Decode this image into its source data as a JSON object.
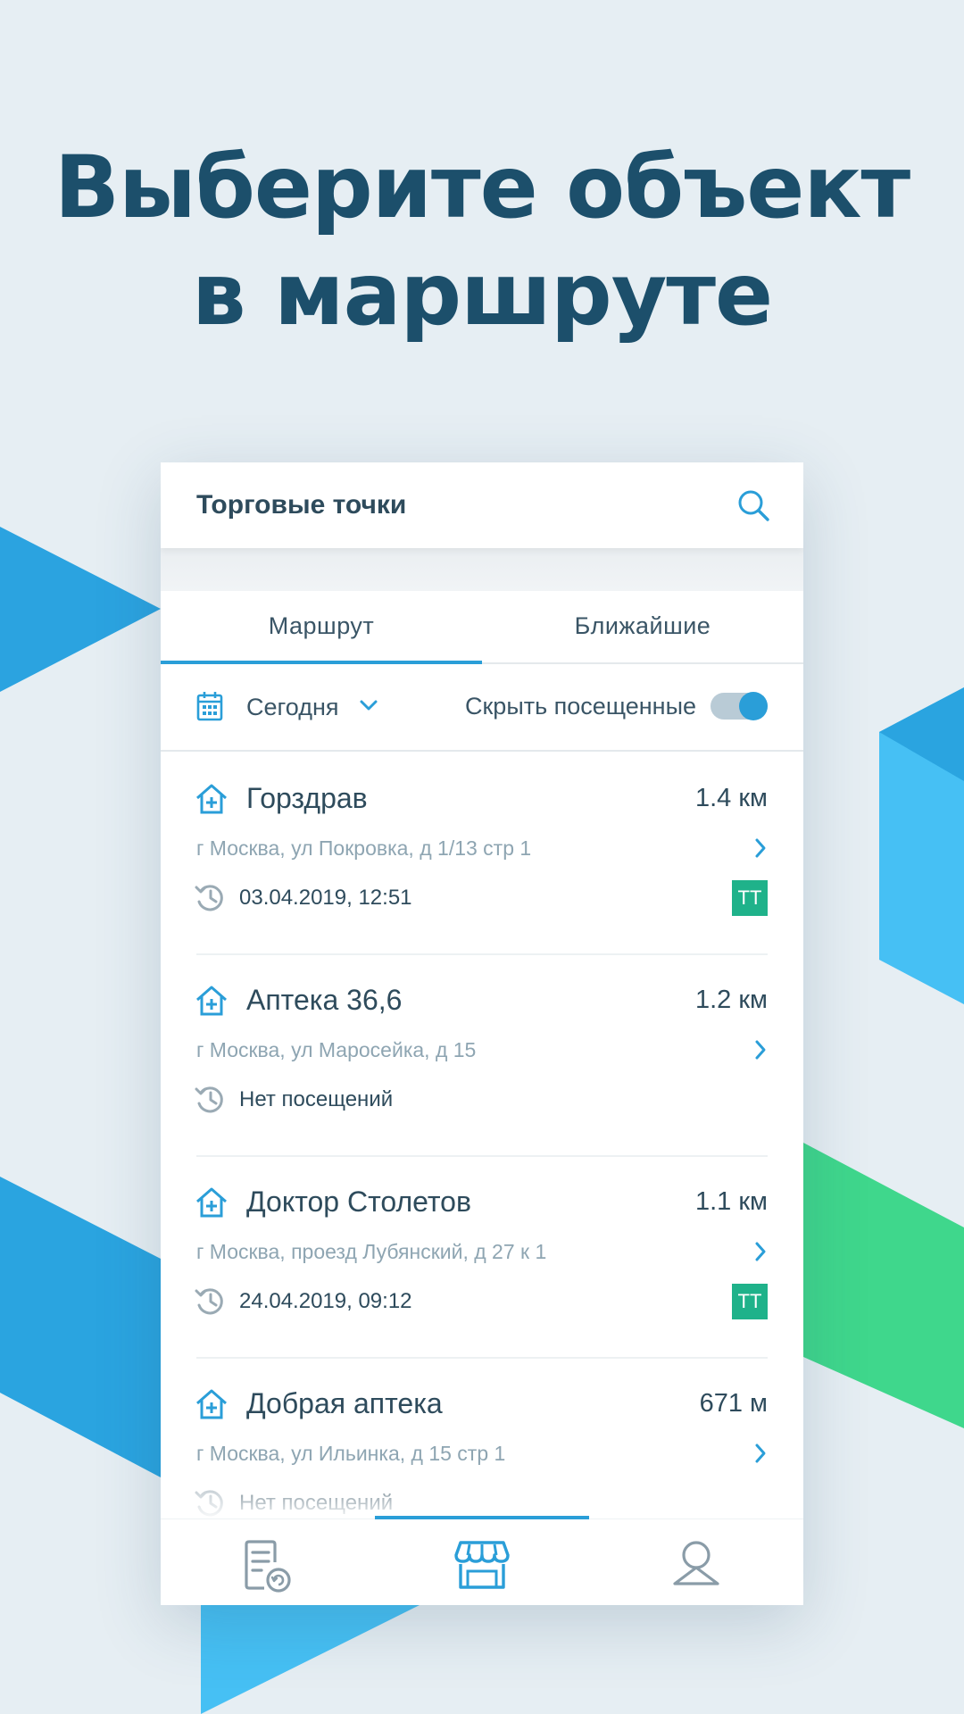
{
  "headline": {
    "line1": "Выберите объект",
    "line2": "в маршруте"
  },
  "topbar": {
    "title": "Торговые точки",
    "search_icon": "search-icon"
  },
  "tabs": [
    {
      "label": "Маршрут",
      "active": true
    },
    {
      "label": "Ближайшие",
      "active": false
    }
  ],
  "filter": {
    "date_label": "Сегодня",
    "hide_visited_label": "Скрыть посещенные",
    "hide_visited_on": true
  },
  "outlets": [
    {
      "name": "Горздрав",
      "distance": "1.4 км",
      "address": "г Москва, ул Покровка, д 1/13 стр 1",
      "last_visit": "03.04.2019, 12:51",
      "badge": "ТТ"
    },
    {
      "name": "Аптека 36,6",
      "distance": "1.2 км",
      "address": "г Москва, ул Маросейка, д 15",
      "last_visit": "Нет посещений",
      "badge": ""
    },
    {
      "name": "Доктор Столетов",
      "distance": "1.1 км",
      "address": "г Москва, проезд Лубянский, д 27 к 1",
      "last_visit": "24.04.2019, 09:12",
      "badge": "ТТ"
    },
    {
      "name": "Добрая аптека",
      "distance": "671 м",
      "address": "г Москва, ул Ильинка, д 15 стр 1",
      "last_visit": "Нет посещений",
      "badge": ""
    }
  ],
  "bottom_nav": [
    {
      "icon": "report-icon",
      "active": false
    },
    {
      "icon": "store-icon",
      "active": true
    },
    {
      "icon": "profile-icon",
      "active": false
    }
  ],
  "colors": {
    "accent": "#2a9ed8",
    "badge": "#1fb28a",
    "title": "#1c4f6b",
    "text": "#2e4b5c",
    "muted": "#8ea5b2"
  }
}
